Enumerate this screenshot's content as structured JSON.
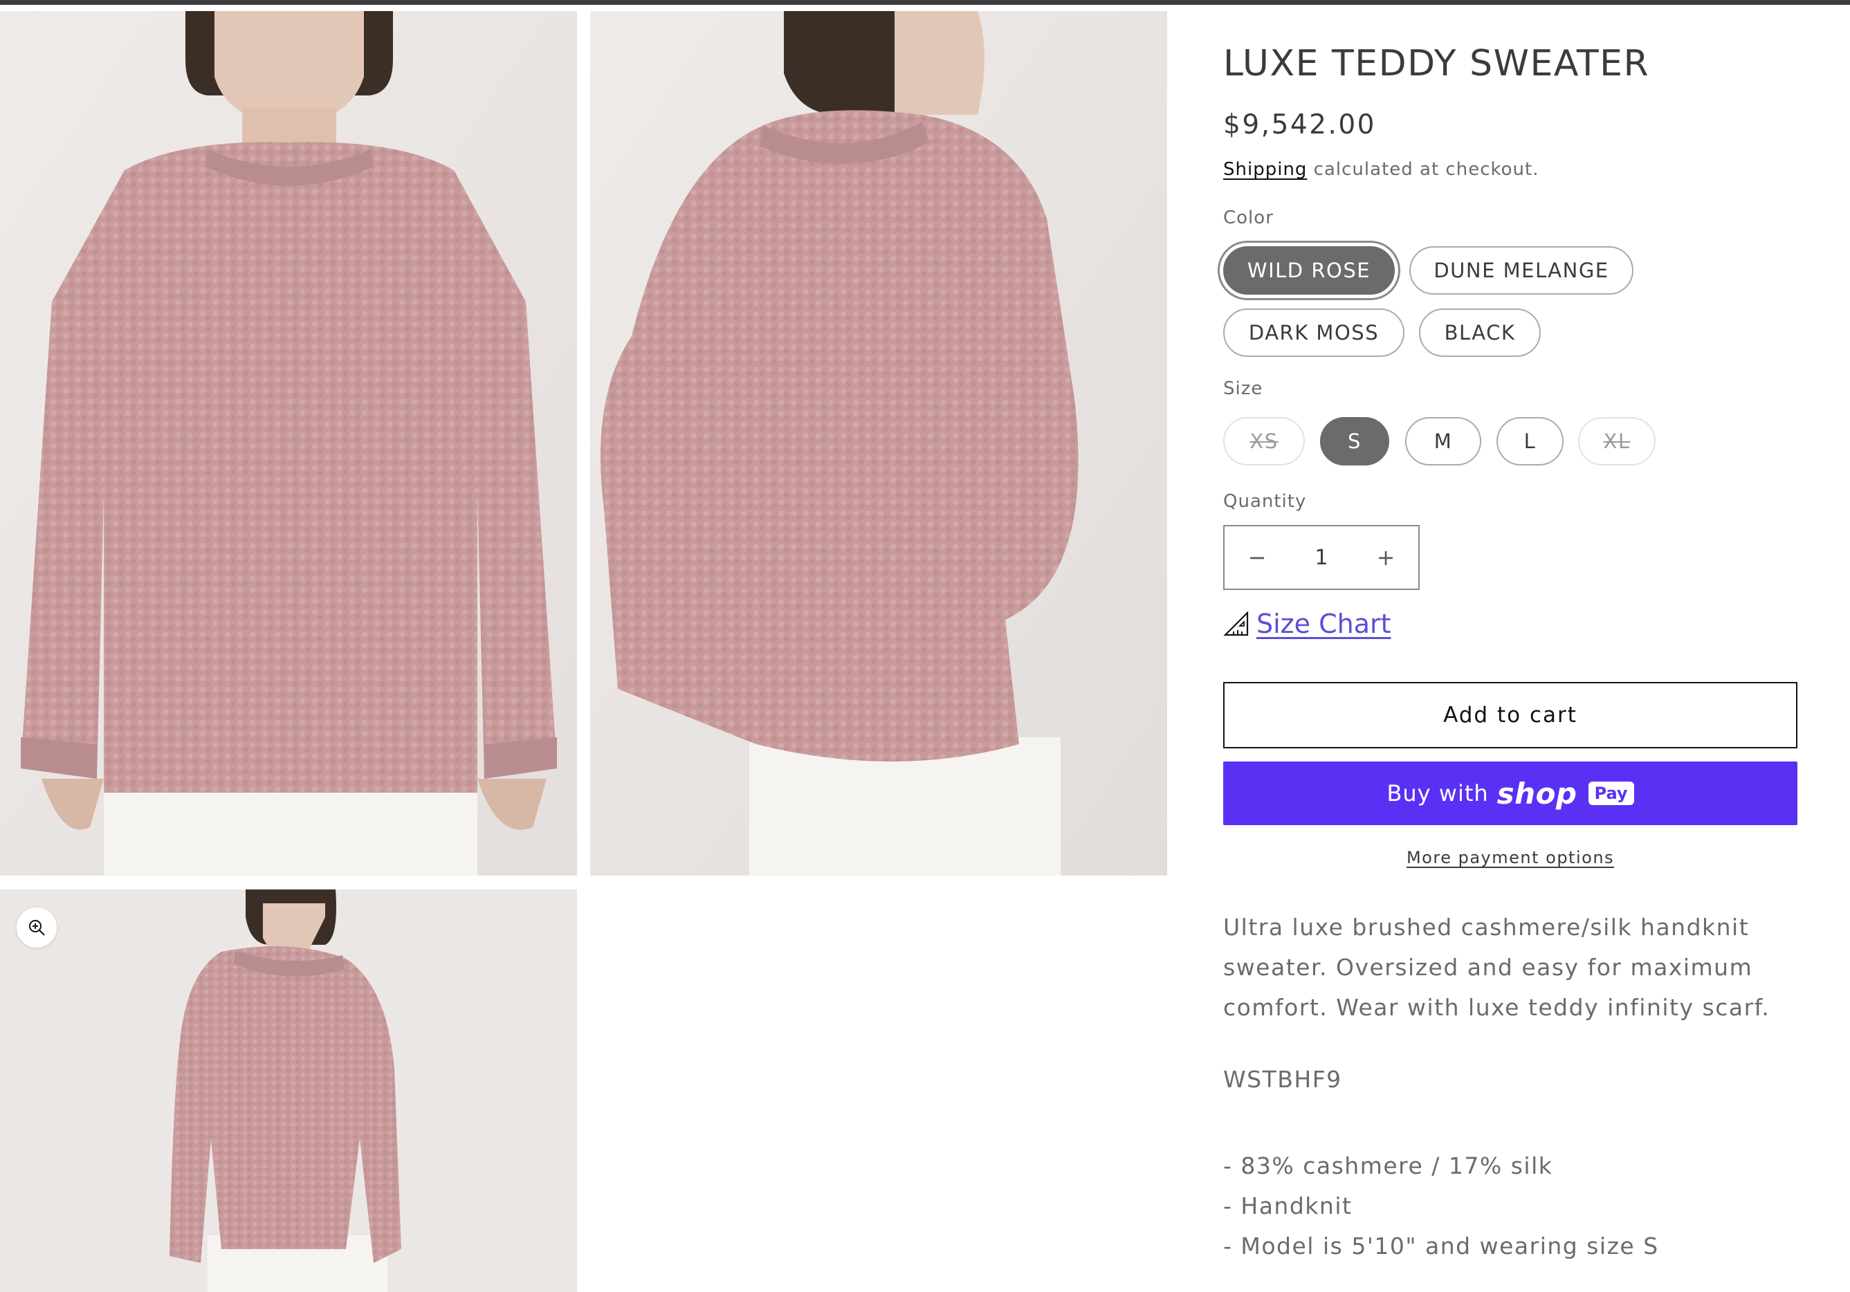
{
  "product": {
    "title": "LUXE TEDDY SWEATER",
    "price": "$9,542.00",
    "shipping_link": "Shipping",
    "shipping_suffix": " calculated at checkout."
  },
  "color": {
    "label": "Color",
    "options": [
      "WILD ROSE",
      "DUNE MELANGE",
      "DARK MOSS",
      "BLACK"
    ],
    "selected": "WILD ROSE"
  },
  "size": {
    "label": "Size",
    "options": [
      "XS",
      "S",
      "M",
      "L",
      "XL"
    ],
    "selected": "S",
    "unavailable": [
      "XS",
      "XL"
    ]
  },
  "quantity": {
    "label": "Quantity",
    "value": "1",
    "decrease": "−",
    "increase": "+"
  },
  "size_chart": {
    "label": "Size Chart",
    "icon": "ruler-icon"
  },
  "actions": {
    "add_to_cart": "Add to cart",
    "shop_pay_prefix": "Buy with",
    "shop_pay_brand": "shop",
    "shop_pay_badge": "Pay",
    "more_payment": "More payment options"
  },
  "description": {
    "text": "Ultra luxe brushed cashmere/silk handknit sweater. Oversized and easy for maximum comfort. Wear with luxe teddy infinity scarf.",
    "sku": "WSTBHF9",
    "features": [
      "- 83% cashmere / 17% silk",
      "- Handknit",
      "- Model is 5'10\" and wearing size S"
    ]
  },
  "gallery": {
    "zoom_icon": "zoom-in-icon",
    "images": [
      "sweater-front",
      "sweater-side",
      "sweater-three-quarter"
    ]
  },
  "colors": {
    "accent": "#5a31f4",
    "link": "#5a4fd6",
    "pill_selected": "#6b6b6b",
    "sweater": "#c99a9c",
    "backdrop": "#ece8e6"
  }
}
